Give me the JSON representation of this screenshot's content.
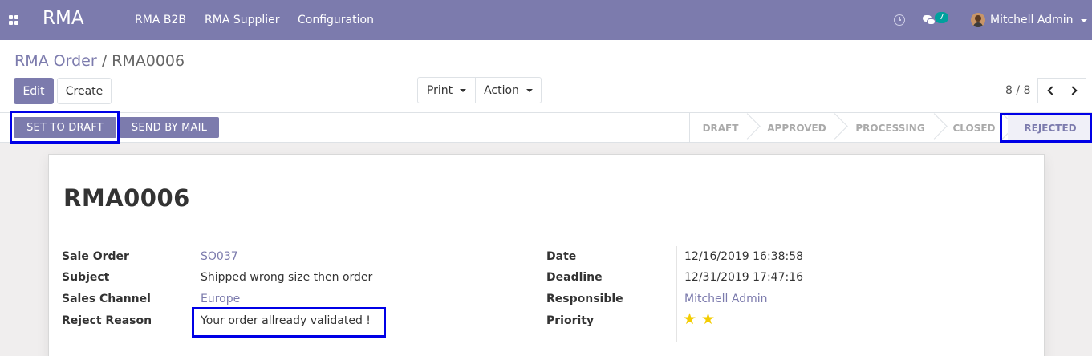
{
  "navbar": {
    "app_title": "RMA",
    "menu": [
      "RMA B2B",
      "RMA Supplier",
      "Configuration"
    ],
    "chat_count": "7",
    "user_name": "Mitchell Admin"
  },
  "breadcrumb": {
    "parent": "RMA Order",
    "separator": "/",
    "current": "RMA0006"
  },
  "buttons": {
    "edit": "Edit",
    "create": "Create",
    "print": "Print",
    "action": "Action"
  },
  "pager": {
    "value": "8 / 8"
  },
  "statusbar": {
    "set_to_draft": "SET TO DRAFT",
    "send_by_mail": "SEND BY MAIL",
    "stages": [
      "DRAFT",
      "APPROVED",
      "PROCESSING",
      "CLOSED",
      "REJECTED"
    ],
    "active_stage": "REJECTED"
  },
  "record": {
    "name": "RMA0006",
    "left": [
      {
        "label": "Sale Order",
        "value": "SO037"
      },
      {
        "label": "Subject",
        "value": "Shipped wrong size then order"
      },
      {
        "label": "Sales Channel",
        "value": "Europe"
      },
      {
        "label": "Reject Reason",
        "value": "Your order allready validated !"
      }
    ],
    "right": [
      {
        "label": "Date",
        "value": "12/16/2019 16:38:58"
      },
      {
        "label": "Deadline",
        "value": "12/31/2019 17:47:16"
      },
      {
        "label": "Responsible",
        "value": "Mitchell Admin"
      },
      {
        "label": "Priority",
        "value": 2
      }
    ]
  },
  "colors": {
    "brand": "#7c7bad",
    "highlight": "#0000e6",
    "star": "#f3cc00",
    "badge": "#00a09d"
  },
  "icons": {
    "apps": "apps-grid-icon",
    "clock": "clock-icon",
    "chat": "chat-icon",
    "star": "star-icon"
  }
}
